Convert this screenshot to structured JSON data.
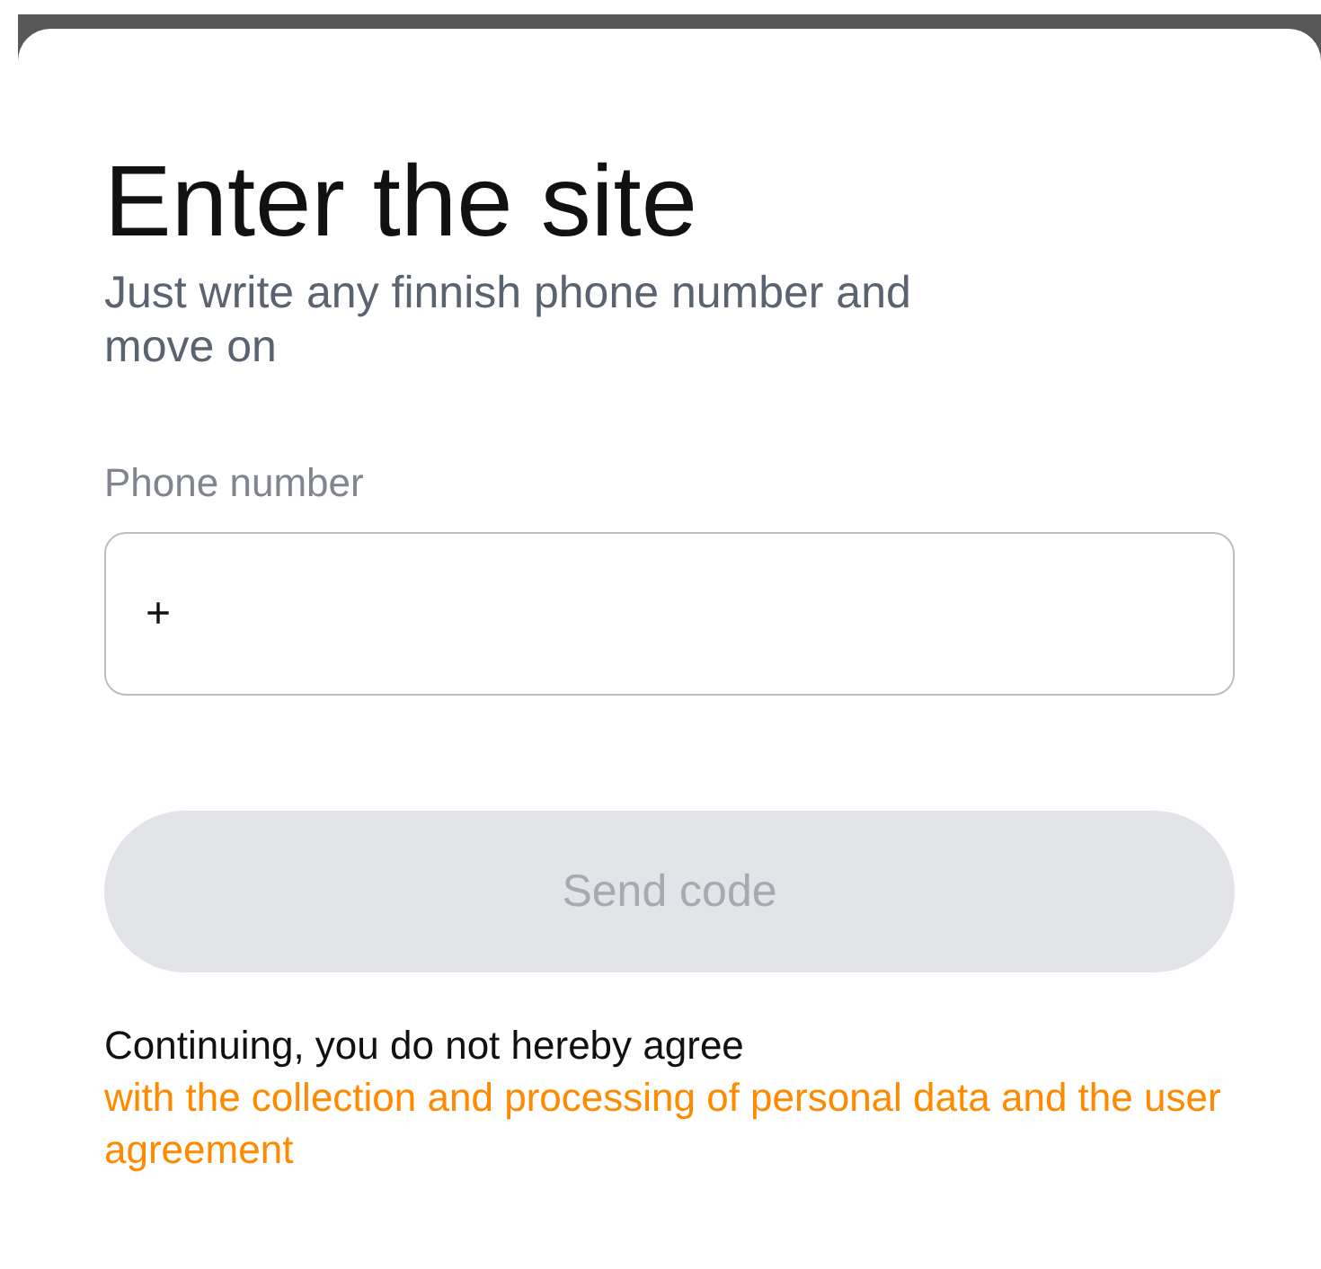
{
  "title": "Enter the site",
  "subtitle": "Just write any finnish phone number and move on",
  "phone_field": {
    "label": "Phone number",
    "value": "+"
  },
  "send_button": {
    "label": "Send code",
    "disabled": true
  },
  "consent": {
    "text": "Continuing, you do not hereby agree",
    "link": "with the collection and processing of personal data and the user agreement"
  }
}
